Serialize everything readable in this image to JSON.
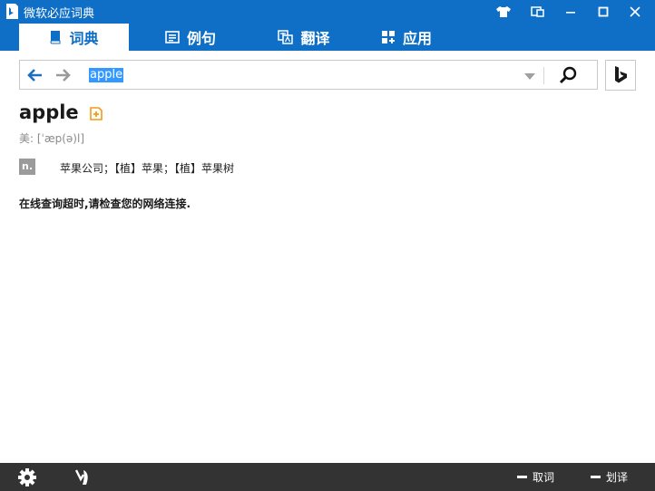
{
  "window": {
    "title": "微软必应词典",
    "controls": [
      "shirt-icon",
      "mini-mode-icon",
      "minimize-icon",
      "maximize-icon",
      "close-icon"
    ]
  },
  "tabs": [
    {
      "label": "词典",
      "icon": "book-icon",
      "active": true
    },
    {
      "label": "例句",
      "icon": "sentences-icon",
      "active": false
    },
    {
      "label": "翻译",
      "icon": "translate-icon",
      "active": false
    },
    {
      "label": "应用",
      "icon": "apps-icon",
      "active": false
    }
  ],
  "search": {
    "query": "apple"
  },
  "entry": {
    "word": "apple",
    "phonetic": "美: [ˈæp(ə)l]",
    "senses": [
      {
        "pos": "n.",
        "definition": "苹果公司；【植】苹果；【植】苹果树"
      }
    ],
    "error_message": "在线查询超时,请检查您的网络连接."
  },
  "bottombar": {
    "word_pick_label": "取词",
    "select_translate_label": "划译"
  },
  "colors": {
    "accent": "#0f6fc6",
    "bottom_bar": "#333333",
    "selection": "#3399ff",
    "vocab_icon": "#f39c12"
  }
}
